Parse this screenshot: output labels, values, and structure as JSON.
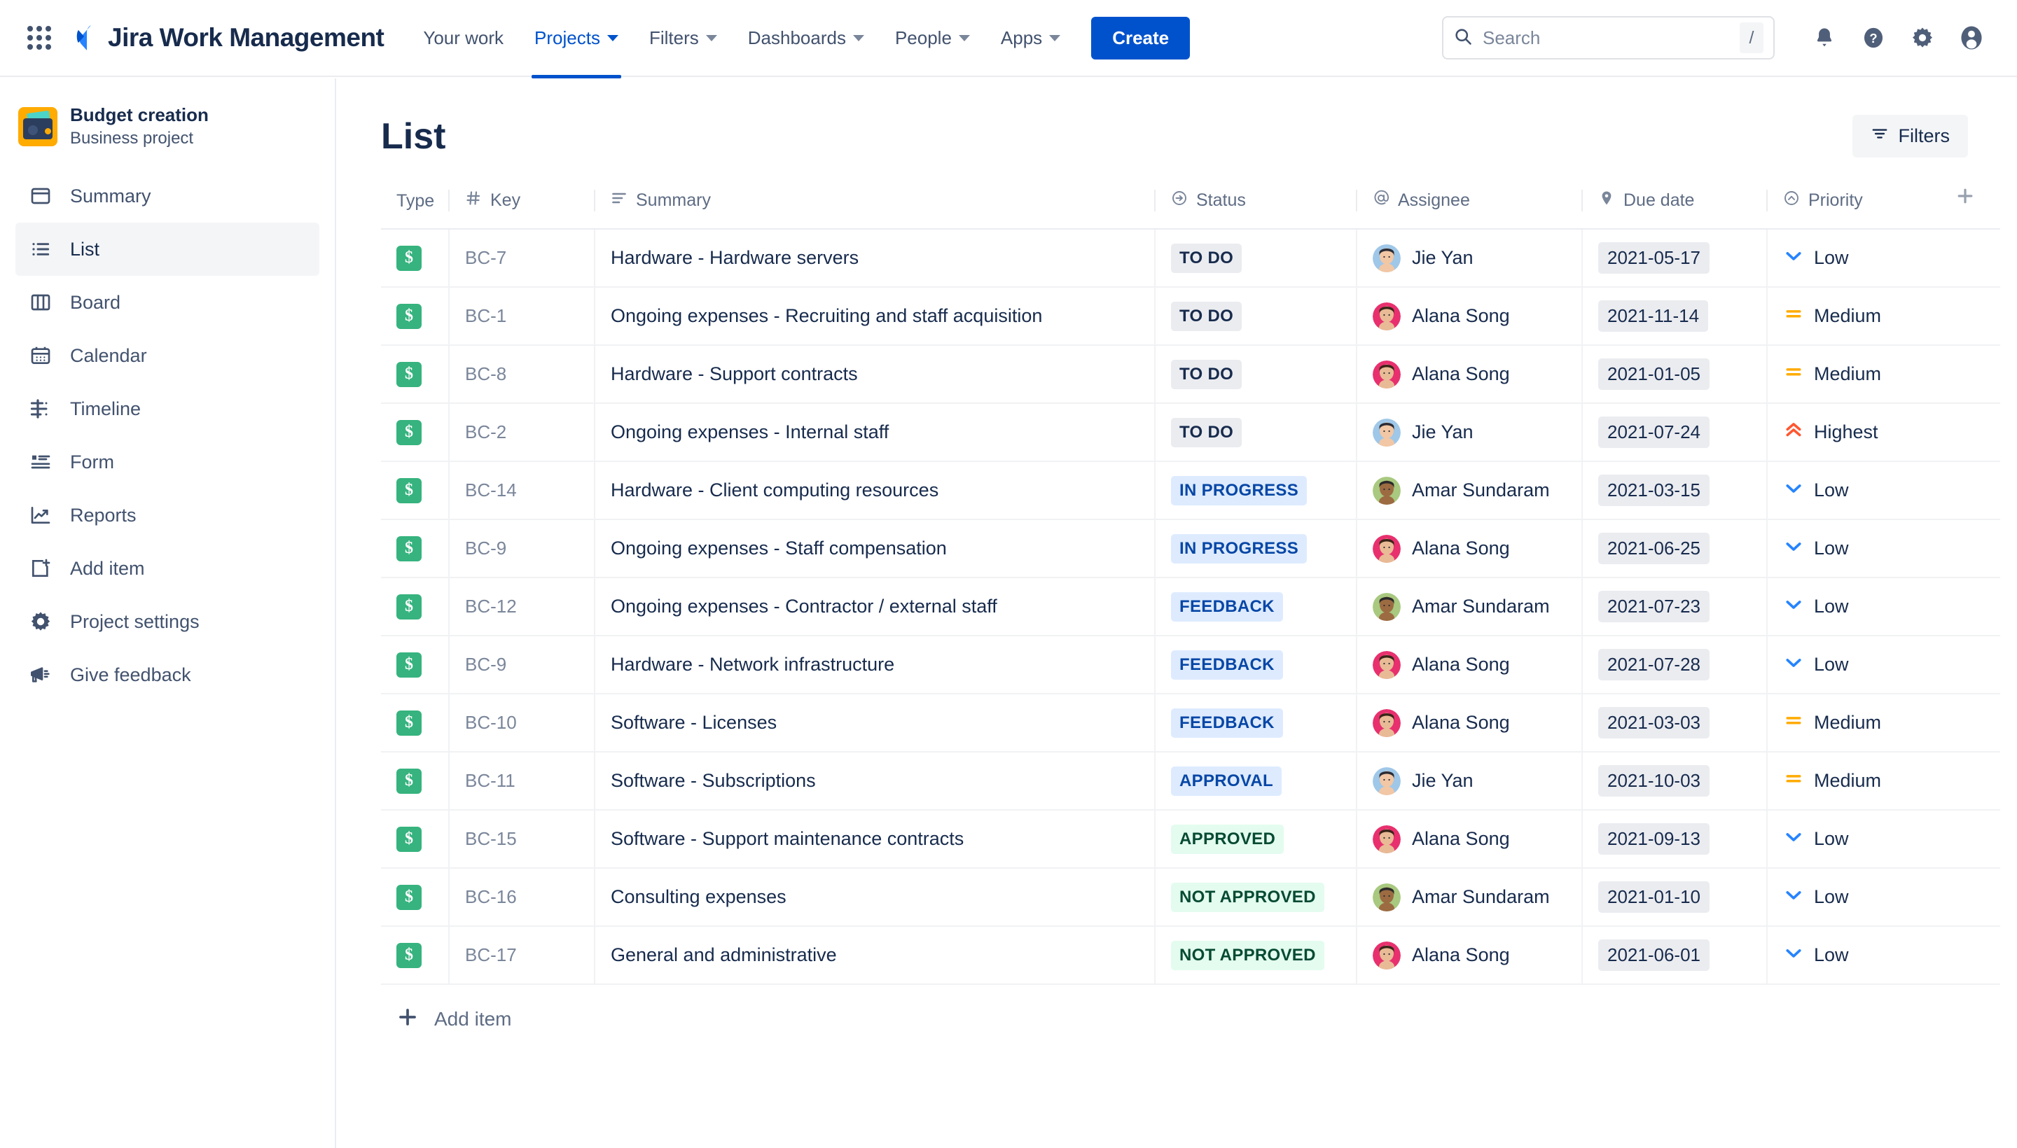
{
  "topnav": {
    "app_switcher_icon": "grid-apps-icon",
    "brand": "Jira Work Management",
    "items": [
      {
        "label": "Your work",
        "has_caret": false,
        "active": false
      },
      {
        "label": "Projects",
        "has_caret": true,
        "active": true
      },
      {
        "label": "Filters",
        "has_caret": true,
        "active": false
      },
      {
        "label": "Dashboards",
        "has_caret": true,
        "active": false
      },
      {
        "label": "People",
        "has_caret": true,
        "active": false
      },
      {
        "label": "Apps",
        "has_caret": true,
        "active": false
      }
    ],
    "create_label": "Create",
    "search": {
      "placeholder": "Search",
      "value": "",
      "shortcut": "/"
    },
    "right_icons": [
      "notifications-bell-icon",
      "help-question-icon",
      "settings-gear-icon",
      "user-avatar-icon"
    ]
  },
  "sidebar": {
    "project": {
      "name": "Budget creation",
      "type": "Business project",
      "avatar_color": "#FFAB00"
    },
    "items": [
      {
        "label": "Summary",
        "icon": "summary-window-icon",
        "active": false
      },
      {
        "label": "List",
        "icon": "list-bullets-icon",
        "active": true
      },
      {
        "label": "Board",
        "icon": "board-columns-icon",
        "active": false
      },
      {
        "label": "Calendar",
        "icon": "calendar-icon",
        "active": false
      },
      {
        "label": "Timeline",
        "icon": "timeline-icon",
        "active": false
      },
      {
        "label": "Form",
        "icon": "form-icon",
        "active": false
      },
      {
        "label": "Reports",
        "icon": "reports-chart-icon",
        "active": false
      },
      {
        "label": "Add item",
        "icon": "add-item-page-icon",
        "active": false
      },
      {
        "label": "Project settings",
        "icon": "gear-icon",
        "active": false
      },
      {
        "label": "Give feedback",
        "icon": "megaphone-icon",
        "active": false
      }
    ]
  },
  "main": {
    "page_title": "List",
    "filters_button": {
      "label": "Filters",
      "icon": "filter-icon"
    },
    "add_column_icon": "plus-icon",
    "add_item_footer": {
      "label": "Add item",
      "icon": "plus-icon"
    },
    "columns": [
      {
        "key": "type",
        "label": "Type",
        "icon": null
      },
      {
        "key": "key",
        "label": "Key",
        "icon": "hash-icon"
      },
      {
        "key": "summary",
        "label": "Summary",
        "icon": "text-lines-icon"
      },
      {
        "key": "status",
        "label": "Status",
        "icon": "arrow-circle-icon"
      },
      {
        "key": "assignee",
        "label": "Assignee",
        "icon": "at-icon"
      },
      {
        "key": "due_date",
        "label": "Due date",
        "icon": "tag-icon"
      },
      {
        "key": "priority",
        "label": "Priority",
        "icon": "chevron-circle-icon"
      }
    ],
    "rows": [
      {
        "type_icon": "task-dollar-icon",
        "key": "BC-7",
        "summary": "Hardware - Hardware servers",
        "status": "TO DO",
        "status_style": "todo",
        "assignee": "Jie Yan",
        "avatar": "avatar-jie",
        "due_date": "2021-05-17",
        "priority": "Low",
        "priority_icon": "priority-low-icon"
      },
      {
        "type_icon": "task-dollar-icon",
        "key": "BC-1",
        "summary": "Ongoing expenses - Recruiting and staff acquisition",
        "status": "TO DO",
        "status_style": "todo",
        "assignee": "Alana Song",
        "avatar": "avatar-alana",
        "due_date": "2021-11-14",
        "priority": "Medium",
        "priority_icon": "priority-medium-icon"
      },
      {
        "type_icon": "task-dollar-icon",
        "key": "BC-8",
        "summary": "Hardware - Support contracts",
        "status": "TO DO",
        "status_style": "todo",
        "assignee": "Alana Song",
        "avatar": "avatar-alana",
        "due_date": "2021-01-05",
        "priority": "Medium",
        "priority_icon": "priority-medium-icon"
      },
      {
        "type_icon": "task-dollar-icon",
        "key": "BC-2",
        "summary": "Ongoing expenses - Internal staff",
        "status": "TO DO",
        "status_style": "todo",
        "assignee": "Jie Yan",
        "avatar": "avatar-jie",
        "due_date": "2021-07-24",
        "priority": "Highest",
        "priority_icon": "priority-highest-icon"
      },
      {
        "type_icon": "task-dollar-icon",
        "key": "BC-14",
        "summary": "Hardware - Client computing resources",
        "status": "IN PROGRESS",
        "status_style": "blue",
        "assignee": "Amar Sundaram",
        "avatar": "avatar-amar",
        "due_date": "2021-03-15",
        "priority": "Low",
        "priority_icon": "priority-low-icon"
      },
      {
        "type_icon": "task-dollar-icon",
        "key": "BC-9",
        "summary": "Ongoing expenses - Staff compensation",
        "status": "IN PROGRESS",
        "status_style": "blue",
        "assignee": "Alana Song",
        "avatar": "avatar-alana",
        "due_date": "2021-06-25",
        "priority": "Low",
        "priority_icon": "priority-low-icon"
      },
      {
        "type_icon": "task-dollar-icon",
        "key": "BC-12",
        "summary": "Ongoing expenses - Contractor / external staff",
        "status": "FEEDBACK",
        "status_style": "blue",
        "assignee": "Amar Sundaram",
        "avatar": "avatar-amar",
        "due_date": "2021-07-23",
        "priority": "Low",
        "priority_icon": "priority-low-icon"
      },
      {
        "type_icon": "task-dollar-icon",
        "key": "BC-9",
        "summary": "Hardware - Network infrastructure",
        "status": "FEEDBACK",
        "status_style": "blue",
        "assignee": "Alana Song",
        "avatar": "avatar-alana",
        "due_date": "2021-07-28",
        "priority": "Low",
        "priority_icon": "priority-low-icon"
      },
      {
        "type_icon": "task-dollar-icon",
        "key": "BC-10",
        "summary": "Software - Licenses",
        "status": "FEEDBACK",
        "status_style": "blue",
        "assignee": "Alana Song",
        "avatar": "avatar-alana",
        "due_date": "2021-03-03",
        "priority": "Medium",
        "priority_icon": "priority-medium-icon"
      },
      {
        "type_icon": "task-dollar-icon",
        "key": "BC-11",
        "summary": "Software - Subscriptions",
        "status": "APPROVAL",
        "status_style": "blue",
        "assignee": "Jie Yan",
        "avatar": "avatar-jie",
        "due_date": "2021-10-03",
        "priority": "Medium",
        "priority_icon": "priority-medium-icon"
      },
      {
        "type_icon": "task-dollar-icon",
        "key": "BC-15",
        "summary": "Software - Support maintenance contracts",
        "status": "APPROVED",
        "status_style": "green",
        "assignee": "Alana Song",
        "avatar": "avatar-alana",
        "due_date": "2021-09-13",
        "priority": "Low",
        "priority_icon": "priority-low-icon"
      },
      {
        "type_icon": "task-dollar-icon",
        "key": "BC-16",
        "summary": "Consulting expenses",
        "status": "NOT APPROVED",
        "status_style": "green",
        "assignee": "Amar Sundaram",
        "avatar": "avatar-amar",
        "due_date": "2021-01-10",
        "priority": "Low",
        "priority_icon": "priority-low-icon"
      },
      {
        "type_icon": "task-dollar-icon",
        "key": "BC-17",
        "summary": "General and administrative",
        "status": "NOT APPROVED",
        "status_style": "green",
        "assignee": "Alana Song",
        "avatar": "avatar-alana",
        "due_date": "2021-06-01",
        "priority": "Low",
        "priority_icon": "priority-low-icon"
      }
    ]
  },
  "colors": {
    "accent": "#0052CC",
    "task_green": "#36B37E",
    "priority_low": "#2684FF",
    "priority_medium": "#FFAB00",
    "priority_highest": "#FF5630",
    "text": "#172B4D",
    "muted": "#5E6C84"
  }
}
